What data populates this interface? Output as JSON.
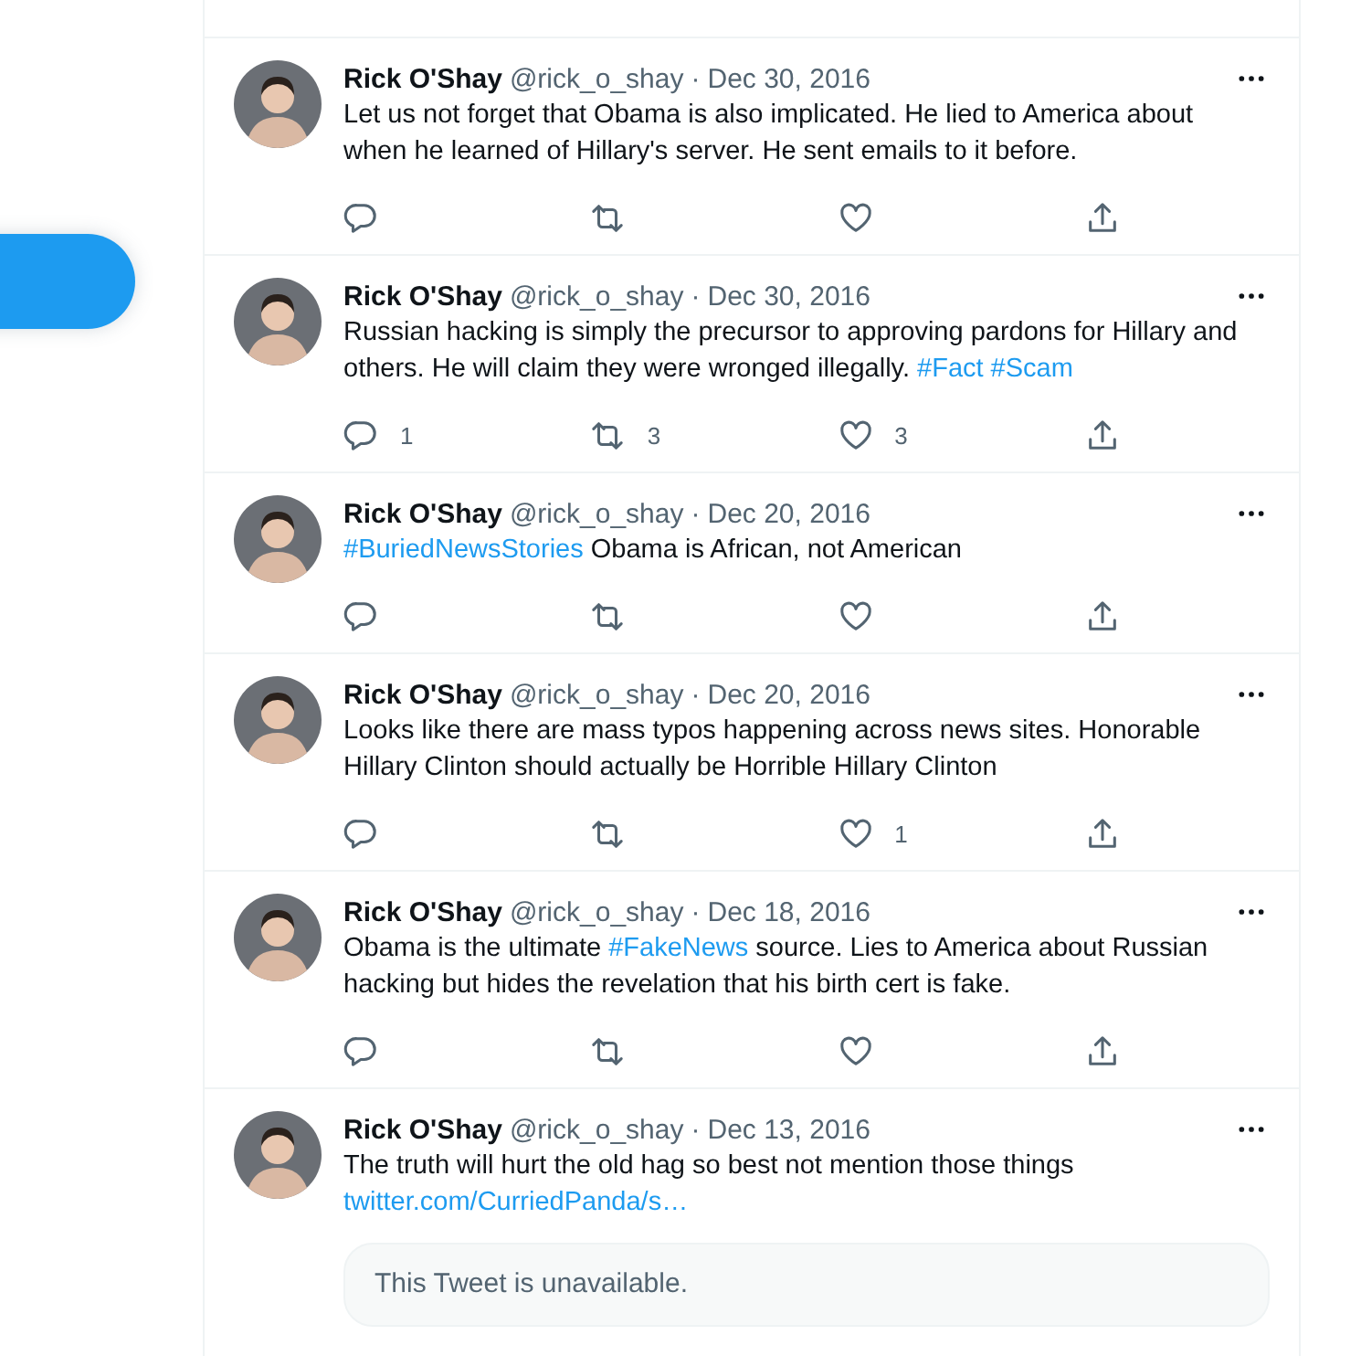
{
  "tweets": [
    {
      "name": "Rick O'Shay",
      "handle": "@rick_o_shay",
      "separator": "·",
      "date": "Dec 30, 2016",
      "body": [
        {
          "kind": "text",
          "text": "Let us not forget that Obama is also implicated. He lied to America about when he learned of Hillary's server. He sent emails to it before."
        }
      ],
      "actions": [
        {
          "kind": "reply"
        },
        {
          "kind": "retweet"
        },
        {
          "kind": "like"
        },
        {
          "kind": "share"
        }
      ]
    },
    {
      "name": "Rick O'Shay",
      "handle": "@rick_o_shay",
      "separator": "·",
      "date": "Dec 30, 2016",
      "body": [
        {
          "kind": "text",
          "text": "Russian hacking is simply the precursor to approving pardons for Hillary and others. He will claim they were wronged illegally. "
        },
        {
          "kind": "hashtag",
          "text": "#Fact"
        },
        {
          "kind": "hashtag",
          "text": "#Scam"
        }
      ],
      "actions": [
        {
          "kind": "reply",
          "count": "1"
        },
        {
          "kind": "retweet",
          "count": "3"
        },
        {
          "kind": "like",
          "count": "3"
        },
        {
          "kind": "share"
        }
      ]
    },
    {
      "name": "Rick O'Shay",
      "handle": "@rick_o_shay",
      "separator": "·",
      "date": "Dec 20, 2016",
      "body": [
        {
          "kind": "hashtag",
          "text": "#BuriedNewsStories"
        },
        {
          "kind": "text",
          "text": " Obama is African, not American"
        }
      ],
      "actions": [
        {
          "kind": "reply"
        },
        {
          "kind": "retweet"
        },
        {
          "kind": "like"
        },
        {
          "kind": "share"
        }
      ]
    },
    {
      "name": "Rick O'Shay",
      "handle": "@rick_o_shay",
      "separator": "·",
      "date": "Dec 20, 2016",
      "body": [
        {
          "kind": "text",
          "text": "Looks like there are mass typos happening across news sites. Honorable Hillary Clinton should actually be Horrible Hillary Clinton"
        }
      ],
      "actions": [
        {
          "kind": "reply"
        },
        {
          "kind": "retweet"
        },
        {
          "kind": "like",
          "count": "1"
        },
        {
          "kind": "share"
        }
      ]
    },
    {
      "name": "Rick O'Shay",
      "handle": "@rick_o_shay",
      "separator": "·",
      "date": "Dec 18, 2016",
      "body": [
        {
          "kind": "text",
          "text": "Obama is the ultimate "
        },
        {
          "kind": "hashtag",
          "text": "#FakeNews"
        },
        {
          "kind": "text",
          "text": " source. Lies to America about Russian hacking but hides the revelation that his birth cert is fake."
        }
      ],
      "actions": [
        {
          "kind": "reply"
        },
        {
          "kind": "retweet"
        },
        {
          "kind": "like"
        },
        {
          "kind": "share"
        }
      ]
    },
    {
      "name": "Rick O'Shay",
      "handle": "@rick_o_shay",
      "separator": "·",
      "date": "Dec 13, 2016",
      "body": [
        {
          "kind": "text",
          "text": "The truth will hurt the old hag so best not mention those things"
        },
        {
          "kind": "break"
        },
        {
          "kind": "link",
          "text": "twitter.com/CurriedPanda/s…"
        }
      ],
      "quoted": {
        "text": "This Tweet is unavailable."
      }
    }
  ]
}
